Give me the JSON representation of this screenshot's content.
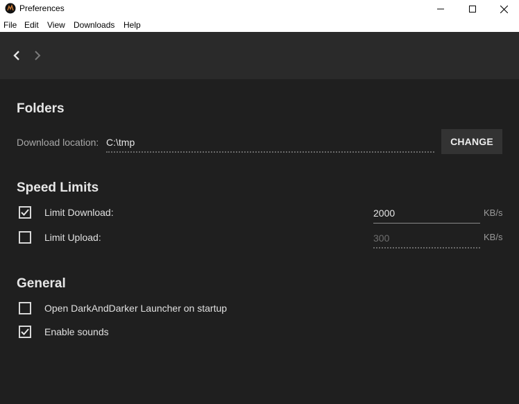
{
  "window": {
    "title": "Preferences",
    "controls": {
      "minimize": "minimize-icon",
      "maximize": "maximize-icon",
      "close": "close-icon"
    }
  },
  "menu": {
    "items": [
      "File",
      "Edit",
      "View",
      "Downloads",
      "Help"
    ]
  },
  "nav": {
    "back_icon": "chevron-left-icon",
    "forward_icon": "chevron-right-icon"
  },
  "folders": {
    "title": "Folders",
    "download_location_label": "Download location:",
    "download_location_value": "C:\\tmp",
    "change_button": "CHANGE"
  },
  "speed_limits": {
    "title": "Speed Limits",
    "limit_download": {
      "label": "Limit Download:",
      "checked": true,
      "value": "2000",
      "unit": "KB/s"
    },
    "limit_upload": {
      "label": "Limit Upload:",
      "checked": false,
      "value": "300",
      "unit": "KB/s"
    }
  },
  "general": {
    "title": "General",
    "open_on_startup": {
      "label": "Open DarkAndDarker Launcher on startup",
      "checked": false
    },
    "enable_sounds": {
      "label": "Enable sounds",
      "checked": true
    }
  },
  "colors": {
    "background": "#1f1f1f",
    "navbar": "#2a2a2a",
    "button": "#333333",
    "text": "#e0e0e0"
  }
}
